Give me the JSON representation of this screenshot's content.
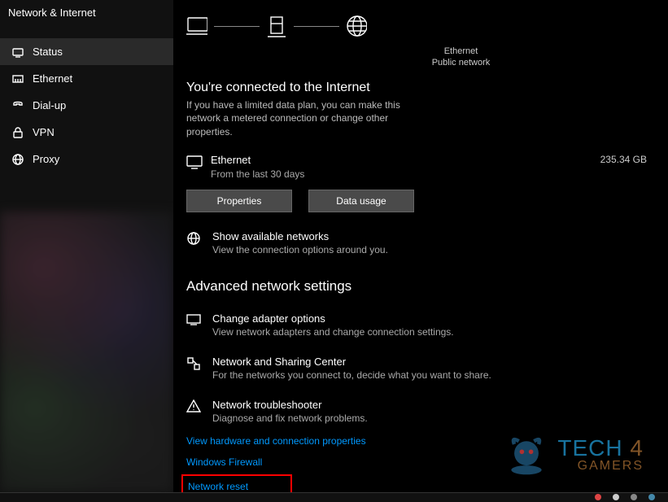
{
  "sidebar": {
    "title": "Network & Internet",
    "items": [
      {
        "label": "Status",
        "icon": "status-icon"
      },
      {
        "label": "Ethernet",
        "icon": "ethernet-icon"
      },
      {
        "label": "Dial-up",
        "icon": "dialup-icon"
      },
      {
        "label": "VPN",
        "icon": "vpn-icon"
      },
      {
        "label": "Proxy",
        "icon": "proxy-icon"
      }
    ]
  },
  "diagram": {
    "mid_label1": "Ethernet",
    "mid_label2": "Public network"
  },
  "status": {
    "heading": "You're connected to the Internet",
    "desc": "If you have a limited data plan, you can make this network a metered connection or change other properties.",
    "conn_name": "Ethernet",
    "conn_sub": "From the last 30 days",
    "conn_usage": "235.34 GB",
    "btn_properties": "Properties",
    "btn_datausage": "Data usage"
  },
  "show_networks": {
    "title": "Show available networks",
    "sub": "View the connection options around you."
  },
  "advanced": {
    "heading": "Advanced network settings",
    "adapter": {
      "title": "Change adapter options",
      "sub": "View network adapters and change connection settings."
    },
    "sharing": {
      "title": "Network and Sharing Center",
      "sub": "For the networks you connect to, decide what you want to share."
    },
    "trouble": {
      "title": "Network troubleshooter",
      "sub": "Diagnose and fix network problems."
    },
    "link_hw": "View hardware and connection properties",
    "link_fw": "Windows Firewall",
    "link_reset": "Network reset"
  },
  "watermark": {
    "line1a": "TECH",
    "line1b": "4",
    "line2": "GAMERS"
  }
}
